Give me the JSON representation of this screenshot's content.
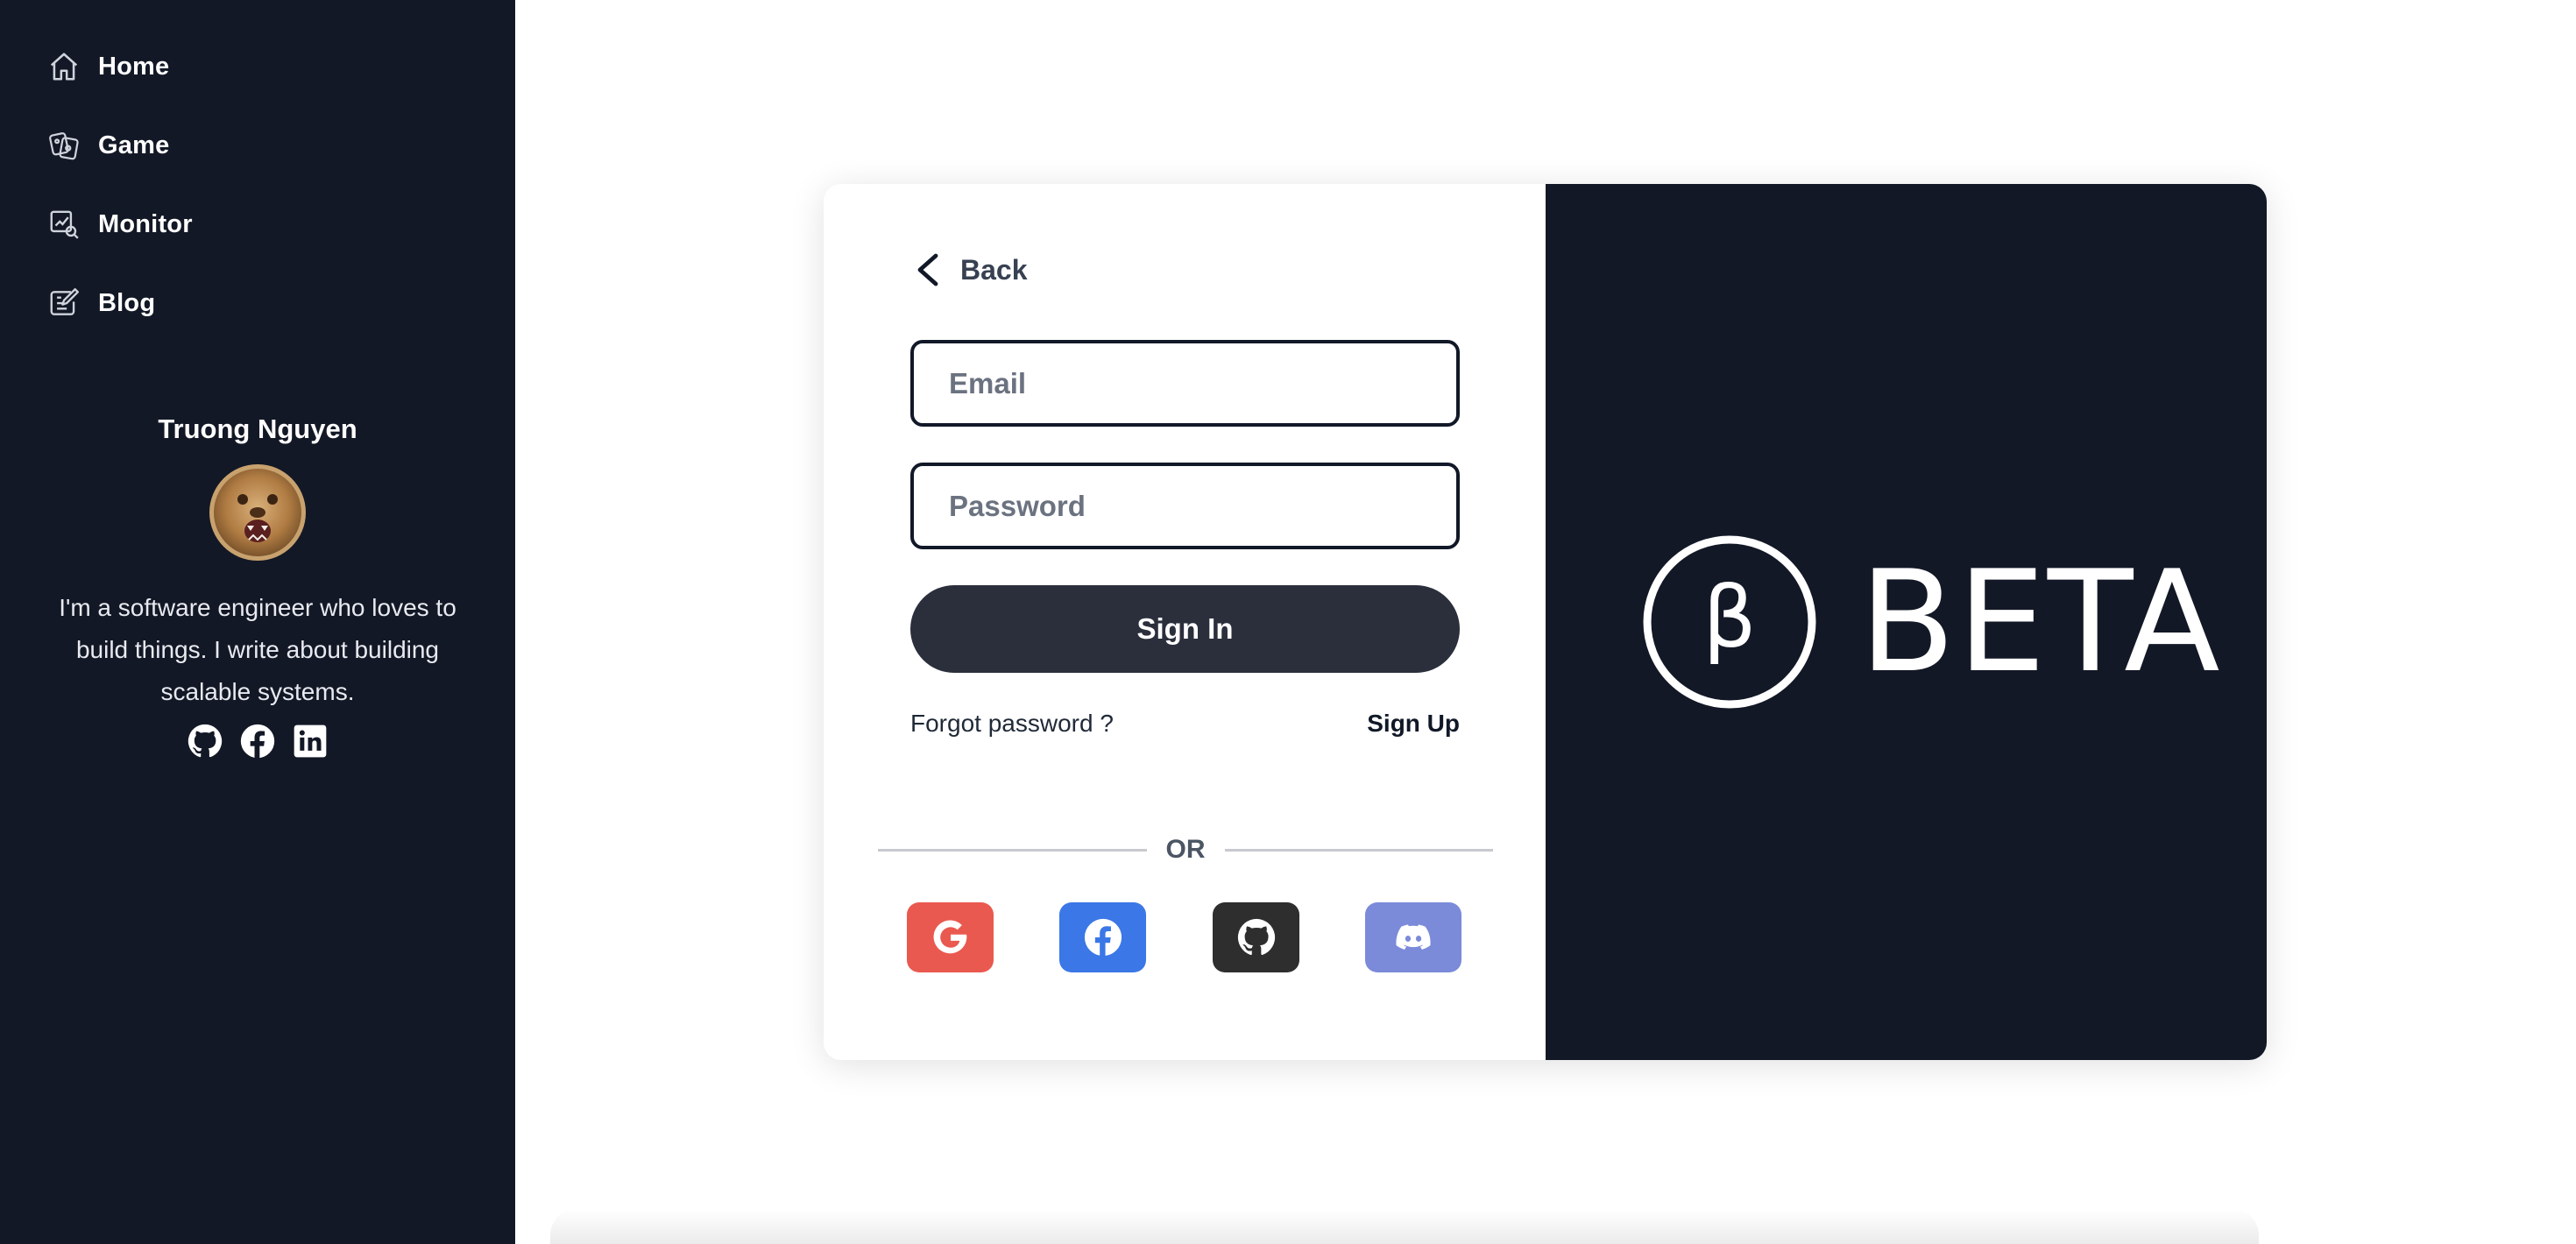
{
  "sidebar": {
    "nav": [
      {
        "label": "Home",
        "icon": "home-icon"
      },
      {
        "label": "Game",
        "icon": "game-icon"
      },
      {
        "label": "Monitor",
        "icon": "monitor-icon"
      },
      {
        "label": "Blog",
        "icon": "blog-icon"
      }
    ],
    "profile": {
      "name": "Truong Nguyen",
      "bio": "I'm a software engineer who loves to build things. I write about building scalable systems.",
      "socials": [
        "github-icon",
        "facebook-icon",
        "linkedin-icon"
      ]
    }
  },
  "login": {
    "back_label": "Back",
    "email_placeholder": "Email",
    "password_placeholder": "Password",
    "signin_label": "Sign In",
    "forgot_label": "Forgot password ?",
    "signup_label": "Sign Up",
    "divider_label": "OR",
    "oauth": [
      {
        "name": "google",
        "color": "#e9594f"
      },
      {
        "name": "facebook",
        "color": "#3b77e6"
      },
      {
        "name": "github",
        "color": "#2e2e2e"
      },
      {
        "name": "discord",
        "color": "#7b8ad9"
      }
    ]
  },
  "brand": {
    "text": "BETA",
    "symbol": "β"
  },
  "colors": {
    "sidebar_bg": "#131826",
    "panel_bg": "#131826",
    "primary_button": "#2b2f3c"
  }
}
